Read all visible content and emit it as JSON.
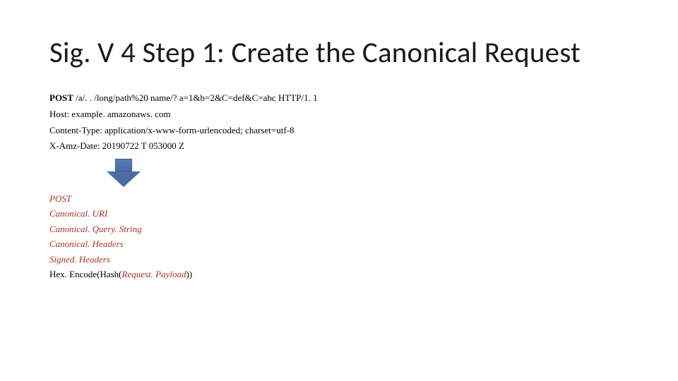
{
  "title": "Sig. V 4 Step 1: Create the Canonical Request",
  "request": {
    "method": "POST",
    "line1_rest": " /a/. . /long/path%20 name/? a=1&b=2&C=def&C=abc HTTP/1. 1",
    "host": "Host: example. amazonaws. com",
    "ctype": "Content-Type: application/x-www-form-urlencoded; charset=utf-8",
    "amzdate": "X-Amz-Date: 20190722 T 053000 Z"
  },
  "canon": {
    "method": "POST",
    "uri": "Canonical. URI",
    "query": "Canonical. Query. String",
    "headers": "Canonical. Headers",
    "signed": "Signed. Headers",
    "hex_pre": "Hex. Encode(Hash(",
    "payload": "Request. Payload",
    "hex_post": "))"
  }
}
